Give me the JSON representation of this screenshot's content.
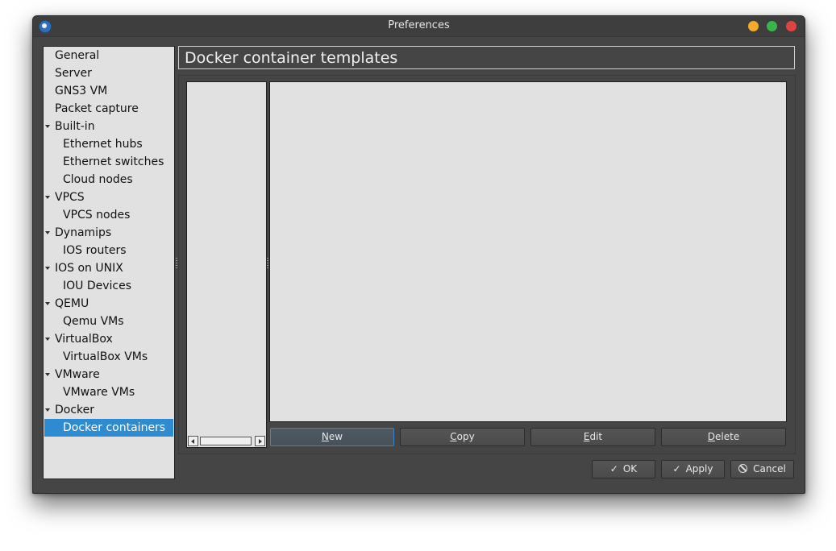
{
  "window": {
    "title": "Preferences",
    "app_icon": "gns3-app-icon"
  },
  "tree": {
    "items": [
      {
        "label": "General",
        "level": 0,
        "expandable": false,
        "selected": false
      },
      {
        "label": "Server",
        "level": 0,
        "expandable": false,
        "selected": false
      },
      {
        "label": "GNS3 VM",
        "level": 0,
        "expandable": false,
        "selected": false
      },
      {
        "label": "Packet capture",
        "level": 0,
        "expandable": false,
        "selected": false
      },
      {
        "label": "Built-in",
        "level": 0,
        "expandable": true,
        "selected": false
      },
      {
        "label": "Ethernet hubs",
        "level": 1,
        "expandable": false,
        "selected": false
      },
      {
        "label": "Ethernet switches",
        "level": 1,
        "expandable": false,
        "selected": false
      },
      {
        "label": "Cloud nodes",
        "level": 1,
        "expandable": false,
        "selected": false
      },
      {
        "label": "VPCS",
        "level": 0,
        "expandable": true,
        "selected": false
      },
      {
        "label": "VPCS nodes",
        "level": 1,
        "expandable": false,
        "selected": false
      },
      {
        "label": "Dynamips",
        "level": 0,
        "expandable": true,
        "selected": false
      },
      {
        "label": "IOS routers",
        "level": 1,
        "expandable": false,
        "selected": false
      },
      {
        "label": "IOS on UNIX",
        "level": 0,
        "expandable": true,
        "selected": false
      },
      {
        "label": "IOU Devices",
        "level": 1,
        "expandable": false,
        "selected": false
      },
      {
        "label": "QEMU",
        "level": 0,
        "expandable": true,
        "selected": false
      },
      {
        "label": "Qemu VMs",
        "level": 1,
        "expandable": false,
        "selected": false
      },
      {
        "label": "VirtualBox",
        "level": 0,
        "expandable": true,
        "selected": false
      },
      {
        "label": "VirtualBox VMs",
        "level": 1,
        "expandable": false,
        "selected": false
      },
      {
        "label": "VMware",
        "level": 0,
        "expandable": true,
        "selected": false
      },
      {
        "label": "VMware VMs",
        "level": 1,
        "expandable": false,
        "selected": false
      },
      {
        "label": "Docker",
        "level": 0,
        "expandable": true,
        "selected": false
      },
      {
        "label": "Docker containers",
        "level": 1,
        "expandable": false,
        "selected": true
      }
    ],
    "selected_color": "#2e8bd0"
  },
  "page": {
    "title": "Docker container templates"
  },
  "actions": {
    "new_key": "N",
    "new_rest": "ew",
    "copy_key": "C",
    "copy_rest": "opy",
    "edit_key": "E",
    "edit_rest": "dit",
    "delete_key": "D",
    "delete_rest": "elete"
  },
  "dialog_buttons": {
    "ok_label": "OK",
    "apply_label": "Apply",
    "cancel_label": "Cancel",
    "check_glyph": "✓"
  },
  "colors": {
    "window_bg": "#454545",
    "panel_bg": "#e1e1e1",
    "close": "#e04343",
    "minimize": "#f2ab2a",
    "maximize": "#3ab54a"
  }
}
